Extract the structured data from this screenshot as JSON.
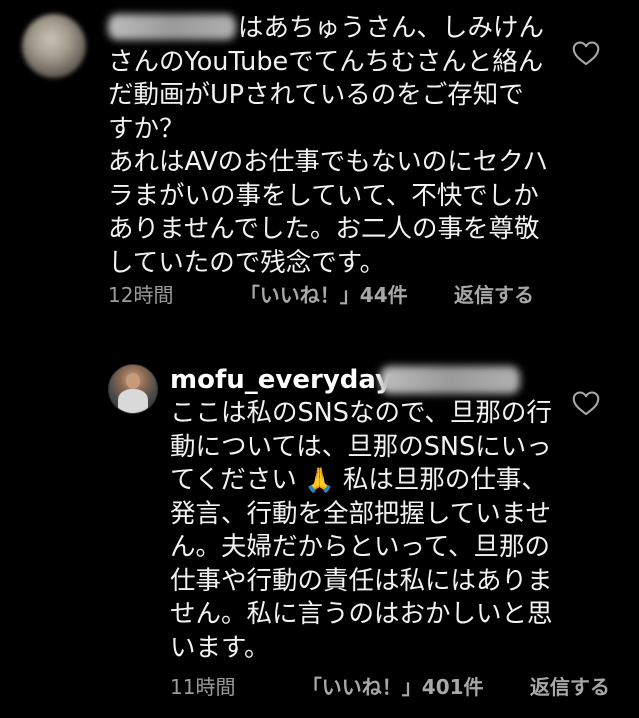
{
  "comments": [
    {
      "username_hidden": true,
      "paragraph1": "はあちゅうさん、しみけんさんのYouTubeでてんちむさんと絡んだ動画がUPされているのをご存知ですか？",
      "paragraph2": "あれはAVのお仕事でもないのにセクハラまがいの事をしていて、不快でしかありませんでした。お二人の事を尊敬していたので残念です。",
      "time": "12時間",
      "likes": "「いいね！」44件",
      "reply": "返信する",
      "liked": false
    },
    {
      "username": "mofu_everyday",
      "text_before_emoji": "ここは私のSNSなので、旦那の行動については、旦那のSNSにいってください",
      "emoji": "🙏",
      "text_after_emoji": "私は旦那の仕事、発言、行動を全部把握していません。夫婦だからといって、旦那の仕事や行動の責任は私にはありません。私に言うのはおかしいと思います。",
      "time": "11時間",
      "likes": "「いいね！」401件",
      "reply": "返信する",
      "liked": false
    }
  ],
  "icons": {
    "like": "heart-outline-icon",
    "emoji": "folded-hands-emoji"
  },
  "colors": {
    "background": "#000000",
    "text": "#f2f2f2",
    "meta": "#9b9b9b"
  }
}
